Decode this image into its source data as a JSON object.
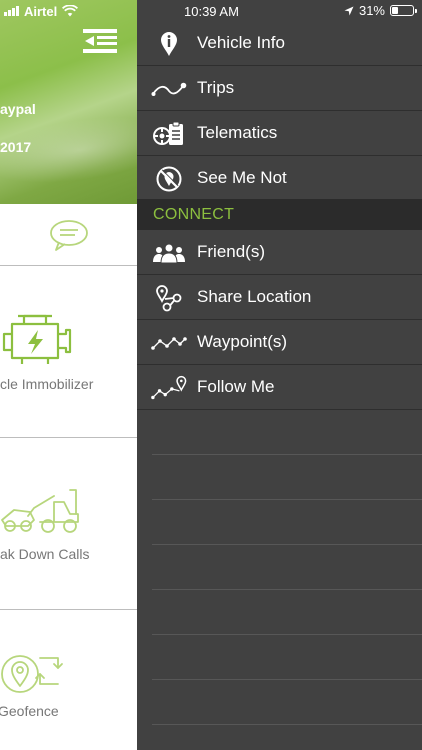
{
  "status_bar": {
    "carrier": "Airtel",
    "time": "10:39 AM",
    "battery_percent": "31%",
    "battery_level": 0.31
  },
  "main": {
    "header": {
      "name_partial": "aypal",
      "year_partial": "2017"
    },
    "tiles": [
      {
        "label": "cle Immobilizer",
        "icon": "engine-icon"
      },
      {
        "label": "ak Down Calls",
        "icon": "tow-truck-icon"
      },
      {
        "label": "Geofence",
        "icon": "geofence-icon"
      }
    ]
  },
  "drawer": {
    "items_top": [
      {
        "label": "Vehicle Info",
        "icon": "info-pin-icon"
      },
      {
        "label": "Trips",
        "icon": "route-icon"
      },
      {
        "label": "Telematics",
        "icon": "telematics-icon"
      },
      {
        "label": "See Me Not",
        "icon": "hidden-location-icon"
      }
    ],
    "section_label": "CONNECT",
    "items_connect": [
      {
        "label": "Friend(s)",
        "icon": "friends-icon"
      },
      {
        "label": "Share Location",
        "icon": "share-location-icon"
      },
      {
        "label": "Waypoint(s)",
        "icon": "waypoints-icon"
      },
      {
        "label": "Follow Me",
        "icon": "follow-me-icon"
      }
    ]
  },
  "colors": {
    "drawer_bg": "#414141",
    "section_bg": "#2b2b2b",
    "accent_green": "#8cbf3f"
  }
}
